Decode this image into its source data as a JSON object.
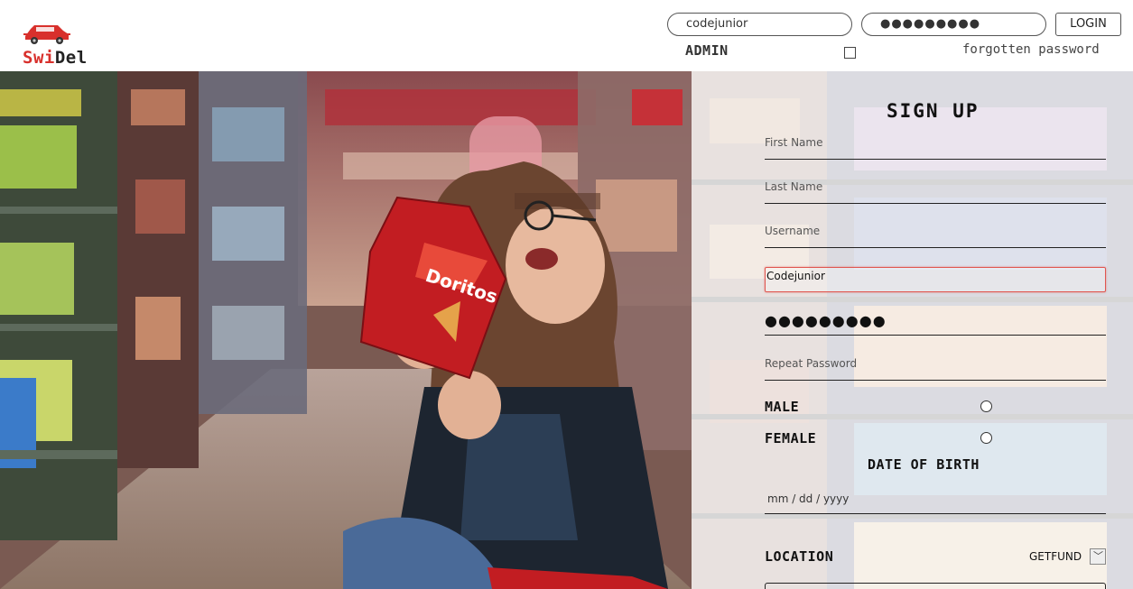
{
  "brand": {
    "name_part1": "Swi",
    "name_part2": "Del",
    "accent_color": "#d8302c",
    "logo_icon": "delivery-car-icon"
  },
  "header": {
    "username_value": "codejunior",
    "password_value": "●●●●●●●●●",
    "login_label": "LOGIN",
    "admin_label": "ADMIN",
    "admin_checked": false,
    "forgot_label": "forgotten password"
  },
  "signup": {
    "title": "SIGN UP",
    "first_name_placeholder": "First Name",
    "last_name_placeholder": "Last Name",
    "username_placeholder": "Username",
    "active_field_value": "Codejunior",
    "password_value": "●●●●●●●●●",
    "repeat_password_placeholder": "Repeat Password",
    "gender": {
      "male_label": "MALE",
      "female_label": "FEMALE",
      "selected": null
    },
    "dob_label": "DATE OF BIRTH",
    "date_placeholder": "mm / dd / yyyy",
    "location_label": "LOCATION",
    "location_selected": "GETFUND"
  }
}
